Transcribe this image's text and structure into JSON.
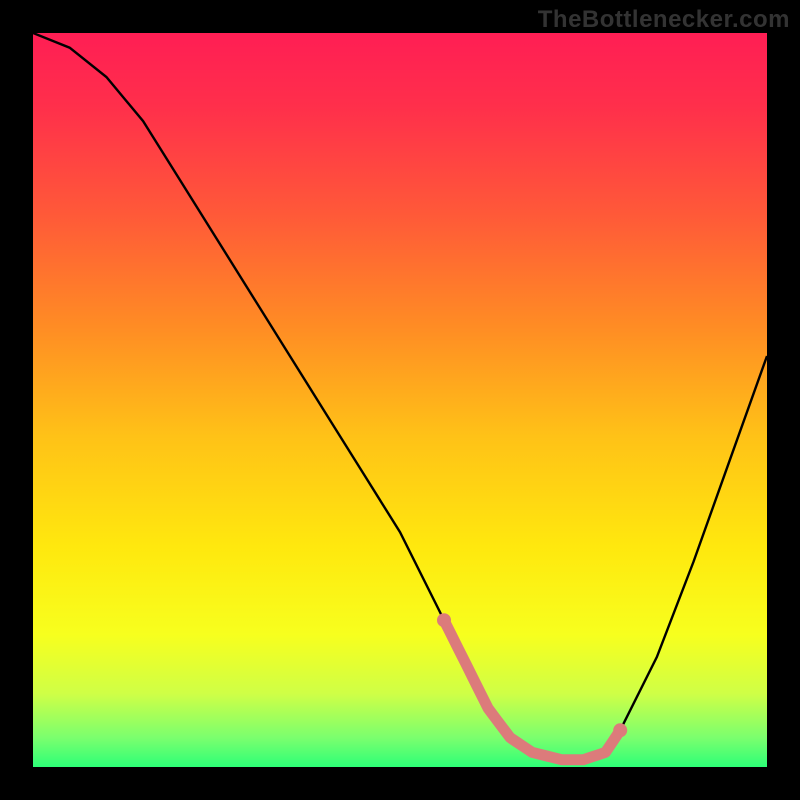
{
  "watermark": "TheBottlenecker.com",
  "chart_data": {
    "type": "line",
    "title": "",
    "xlabel": "",
    "ylabel": "",
    "xlim": [
      0,
      100
    ],
    "ylim": [
      0,
      100
    ],
    "grid": false,
    "series": [
      {
        "name": "curve",
        "color": "#000000",
        "x": [
          0,
          5,
          10,
          15,
          20,
          25,
          30,
          35,
          40,
          45,
          50,
          55,
          56,
          58,
          60,
          62,
          65,
          68,
          72,
          75,
          78,
          80,
          85,
          90,
          95,
          100
        ],
        "y": [
          100,
          98,
          94,
          88,
          80,
          72,
          64,
          56,
          48,
          40,
          32,
          22,
          20,
          16,
          12,
          8,
          4,
          2,
          1,
          1,
          2,
          5,
          15,
          28,
          42,
          56
        ]
      },
      {
        "name": "highlight",
        "color": "#dc7b7b",
        "x": [
          56,
          80
        ],
        "y": [
          20,
          5
        ]
      }
    ],
    "gradient_stops": [
      {
        "offset": 0.0,
        "color": "#ff1e54"
      },
      {
        "offset": 0.1,
        "color": "#ff2f4b"
      },
      {
        "offset": 0.25,
        "color": "#ff5a38"
      },
      {
        "offset": 0.4,
        "color": "#ff8c24"
      },
      {
        "offset": 0.55,
        "color": "#ffc217"
      },
      {
        "offset": 0.7,
        "color": "#ffe80e"
      },
      {
        "offset": 0.82,
        "color": "#f7ff1e"
      },
      {
        "offset": 0.9,
        "color": "#cfff46"
      },
      {
        "offset": 0.96,
        "color": "#7bff6e"
      },
      {
        "offset": 1.0,
        "color": "#2dff77"
      }
    ]
  }
}
